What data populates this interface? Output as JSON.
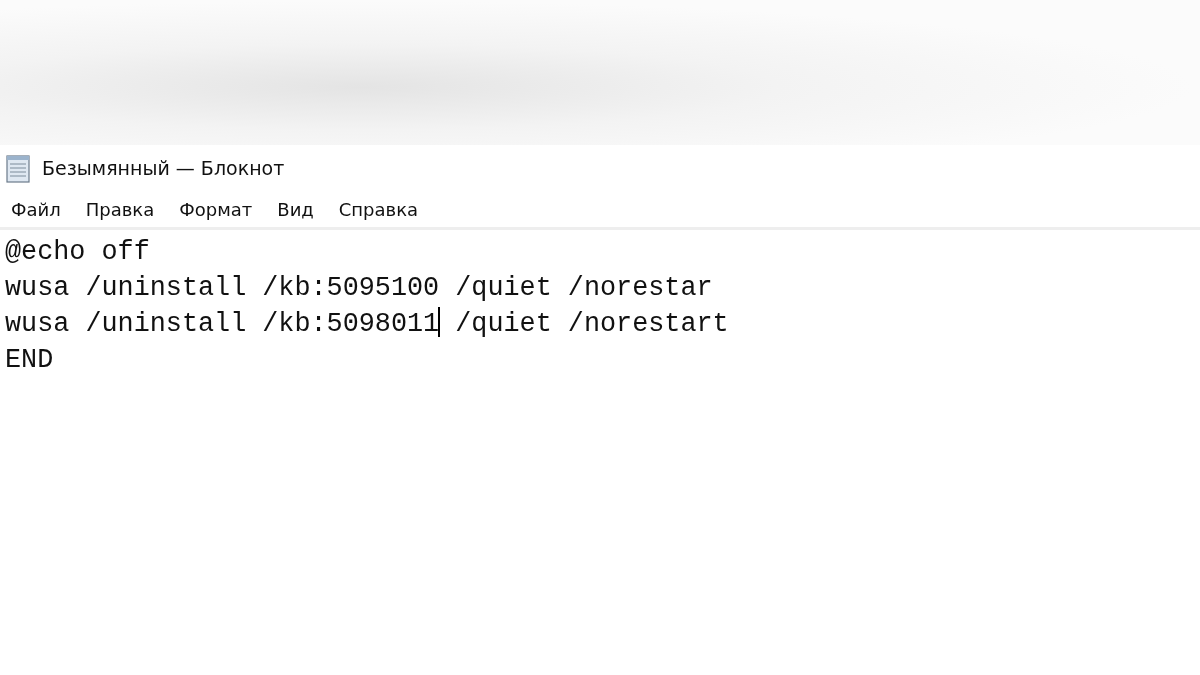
{
  "window": {
    "title": "Безымянный — Блокнот"
  },
  "menu": [
    {
      "label": "Файл"
    },
    {
      "label": "Правка"
    },
    {
      "label": "Формат"
    },
    {
      "label": "Вид"
    },
    {
      "label": "Справка"
    }
  ],
  "editor": {
    "lines": [
      {
        "text": "@echo off"
      },
      {
        "text": "wusa /uninstall /kb:5095100 /quiet /norestar"
      },
      {
        "text": "wusa /uninstall /kb:5098011",
        "after_caret": " /quiet /norestart"
      },
      {
        "text": "END"
      }
    ]
  }
}
